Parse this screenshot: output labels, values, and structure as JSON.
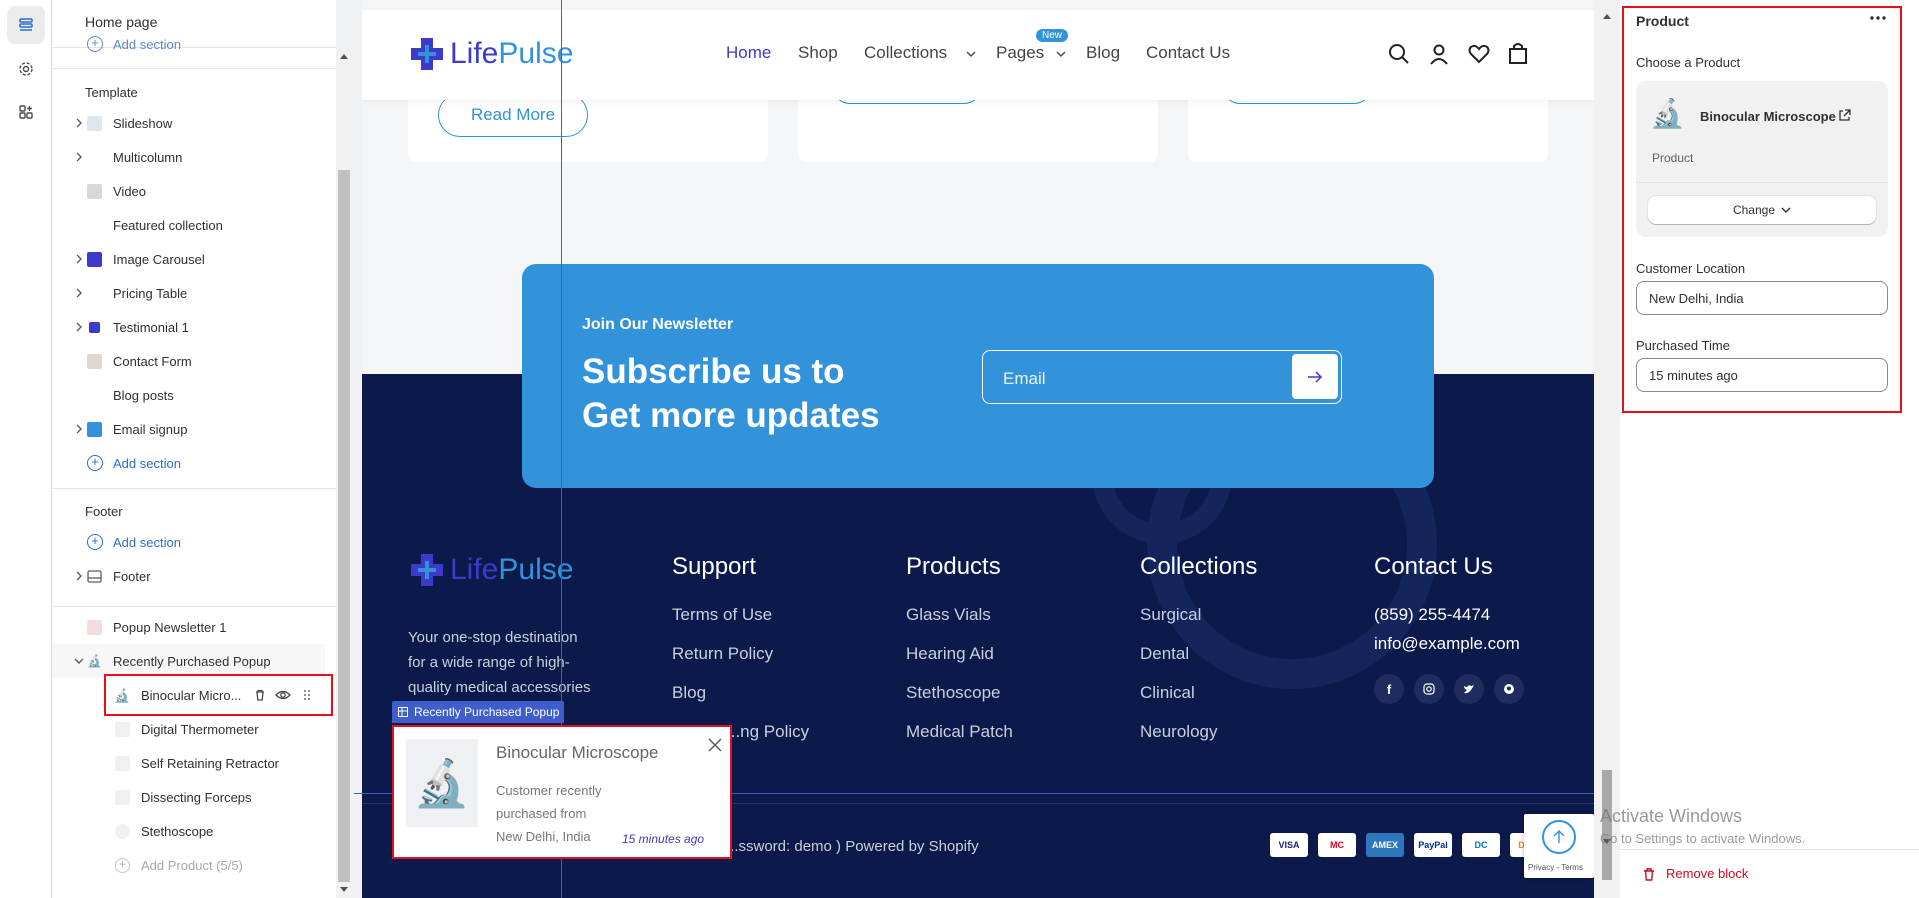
{
  "left_panel": {
    "title": "Home page",
    "scrolled_add_section": "Add section",
    "template_label": "Template",
    "template_items": [
      {
        "label": "Slideshow"
      },
      {
        "label": "Multicolumn"
      },
      {
        "label": "Video"
      },
      {
        "label": "Featured collection"
      },
      {
        "label": "Image Carousel"
      },
      {
        "label": "Pricing Table"
      },
      {
        "label": "Testimonial 1"
      },
      {
        "label": "Contact Form"
      },
      {
        "label": "Blog posts"
      },
      {
        "label": "Email signup"
      }
    ],
    "add_section": "Add section",
    "footer_label": "Footer",
    "footer_add_section": "Add section",
    "footer_item": "Footer",
    "popup_items": [
      {
        "label": "Popup Newsletter 1"
      },
      {
        "label": "Recently Purchased Popup"
      }
    ],
    "popup_children": [
      {
        "label": "Binocular Micro..."
      },
      {
        "label": "Digital Thermometer"
      },
      {
        "label": "Self Retaining Retractor"
      },
      {
        "label": "Dissecting Forceps"
      },
      {
        "label": "Stethoscope"
      }
    ],
    "add_product": "Add Product (5/5)"
  },
  "site": {
    "logo_life": "Life",
    "logo_pulse": "Pulse",
    "nav": [
      "Home",
      "Shop",
      "Collections",
      "Pages",
      "Blog",
      "Contact Us"
    ],
    "new_badge": "New",
    "read_more": "Read More",
    "newsletter_kicker": "Join Our Newsletter",
    "newsletter_line1": "Subscribe us to",
    "newsletter_line2": "Get more updates",
    "email_placeholder": "Email",
    "footer_desc": [
      "Your one-stop destination",
      "for a wide range of high-",
      "quality medical accessories"
    ],
    "support_title": "Support",
    "support_links": [
      "Terms of Use",
      "Return Policy",
      "Blog",
      "...ng Policy"
    ],
    "products_title": "Products",
    "products_links": [
      "Glass Vials",
      "Hearing Aid",
      "Stethoscope",
      "Medical Patch"
    ],
    "collections_title": "Collections",
    "collections_links": [
      "Surgical",
      "Dental",
      "Clinical",
      "Neurology"
    ],
    "contact_title": "Contact Us",
    "contact_phone": "(859) 255-4474",
    "contact_email": "info@example.com",
    "copyright": "...ssword: demo ) Powered by Shopify",
    "payments": [
      "VISA",
      "MC",
      "AMEX",
      "PayPal",
      "DC",
      "DISC"
    ],
    "recaptcha": "Privacy - Terms"
  },
  "popup": {
    "tag": "Recently Purchased Popup",
    "product": "Binocular Microscope",
    "line1": "Customer recently",
    "line2": "purchased from",
    "location": "New Delhi, India",
    "time": "15 minutes ago"
  },
  "right_panel": {
    "title": "Product",
    "choose_label": "Choose a Product",
    "product_name": "Binocular Microscope",
    "product_type": "Product",
    "change_button": "Change",
    "location_label": "Customer Location",
    "location_value": "New Delhi, India",
    "time_label": "Purchased Time",
    "time_value": "15 minutes ago",
    "remove_block": "Remove block"
  },
  "windows": {
    "activate_title": "Activate Windows",
    "activate_sub": "Go to Settings to activate Windows."
  },
  "colors": {
    "accent": "#2c6ecb",
    "brand_blue": "#3293da",
    "footer_bg": "#0b1a4a",
    "highlight": "#e5101b"
  }
}
